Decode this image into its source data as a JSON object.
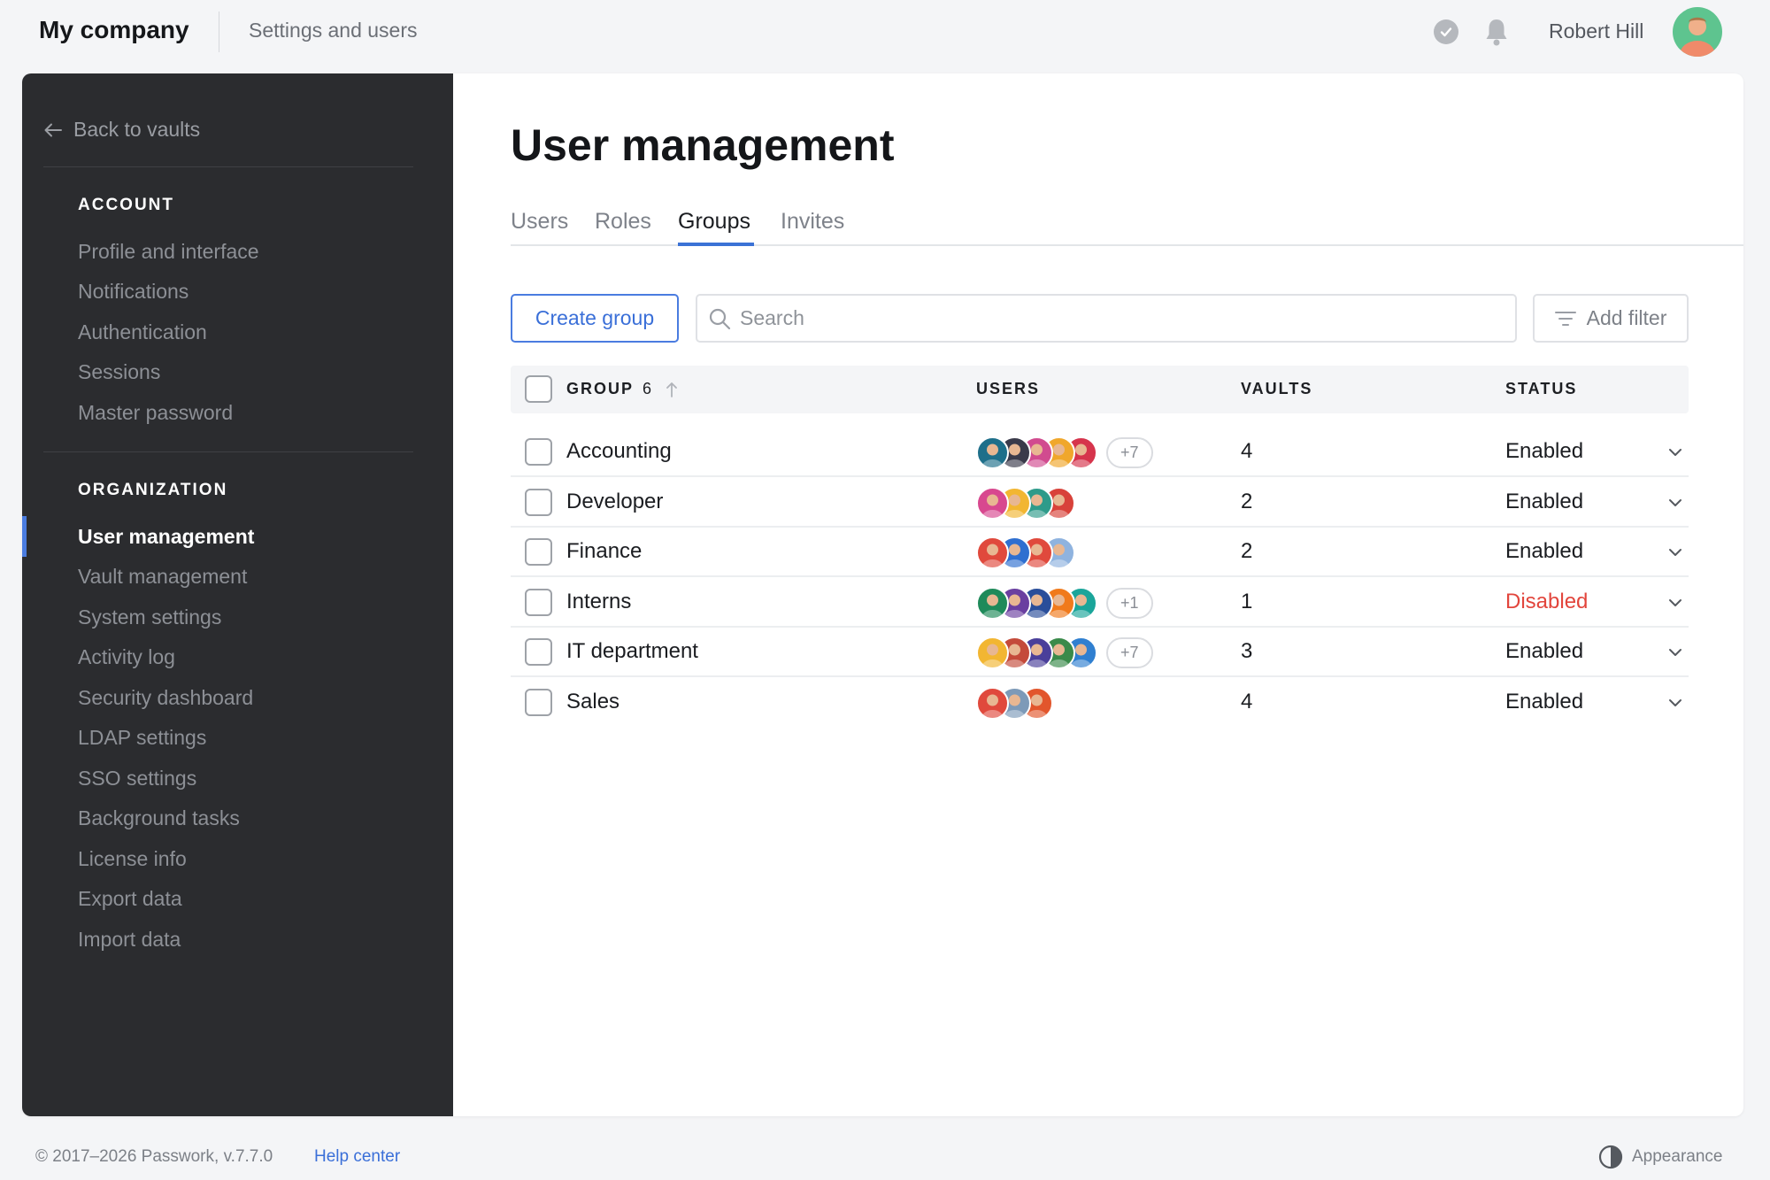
{
  "header": {
    "brand": "My company",
    "section": "Settings and users",
    "user_name": "Robert Hill"
  },
  "sidebar": {
    "back_label": "Back to vaults",
    "account_heading": "ACCOUNT",
    "account_items": [
      "Profile and interface",
      "Notifications",
      "Authentication",
      "Sessions",
      "Master password"
    ],
    "organization_heading": "ORGANIZATION",
    "organization_items": [
      "User management",
      "Vault management",
      "System settings",
      "Activity log",
      "Security dashboard",
      "LDAP settings",
      "SSO settings",
      "Background tasks",
      "License info",
      "Export data",
      "Import data"
    ],
    "active_item": "User management"
  },
  "main": {
    "title": "User management",
    "tabs": [
      "Users",
      "Roles",
      "Groups",
      "Invites"
    ],
    "active_tab": "Groups",
    "create_button": "Create group",
    "search_placeholder": "Search",
    "filter_button": "Add filter",
    "columns": {
      "group": "GROUP",
      "group_count": "6",
      "users": "USERS",
      "vaults": "VAULTS",
      "status": "STATUS"
    },
    "rows": [
      {
        "name": "Accounting",
        "extra_users": "+7",
        "vaults": "4",
        "status": "Enabled",
        "avatar_colors": [
          "#1e6f8a",
          "#3a3a4a",
          "#d14b8f",
          "#f0a72c",
          "#d6344c"
        ]
      },
      {
        "name": "Developer",
        "extra_users": "",
        "vaults": "2",
        "status": "Enabled",
        "avatar_colors": [
          "#d8488f",
          "#f2b632",
          "#2e9b8a",
          "#d8423a"
        ]
      },
      {
        "name": "Finance",
        "extra_users": "",
        "vaults": "2",
        "status": "Enabled",
        "avatar_colors": [
          "#e0493c",
          "#2f6fd0",
          "#e0493c",
          "#8fb3df"
        ]
      },
      {
        "name": "Interns",
        "extra_users": "+1",
        "vaults": "1",
        "status": "Disabled",
        "avatar_colors": [
          "#1f8a5a",
          "#6a3fa0",
          "#2a4e9a",
          "#f07a1c",
          "#1aa59a"
        ]
      },
      {
        "name": "IT department",
        "extra_users": "+7",
        "vaults": "3",
        "status": "Enabled",
        "avatar_colors": [
          "#f2b632",
          "#c44a3a",
          "#4a3f9a",
          "#3a8a4a",
          "#2f7fd0"
        ]
      },
      {
        "name": "Sales",
        "extra_users": "",
        "vaults": "4",
        "status": "Enabled",
        "avatar_colors": [
          "#e0493c",
          "#7d9ab8",
          "#e2562c"
        ]
      }
    ]
  },
  "footer": {
    "copyright": "© 2017–2026 Passwork, v.7.7.0",
    "help": "Help center",
    "appearance": "Appearance"
  },
  "colors": {
    "accent": "#3b72d6",
    "sidebar_bg": "#2b2c2f",
    "disabled": "#e2453c"
  },
  "icons": [
    "check-circle-icon",
    "bell-icon",
    "arrow-left-icon",
    "search-icon",
    "filter-icon",
    "sort-arrow-up-icon",
    "chevron-down-icon",
    "contrast-icon"
  ]
}
